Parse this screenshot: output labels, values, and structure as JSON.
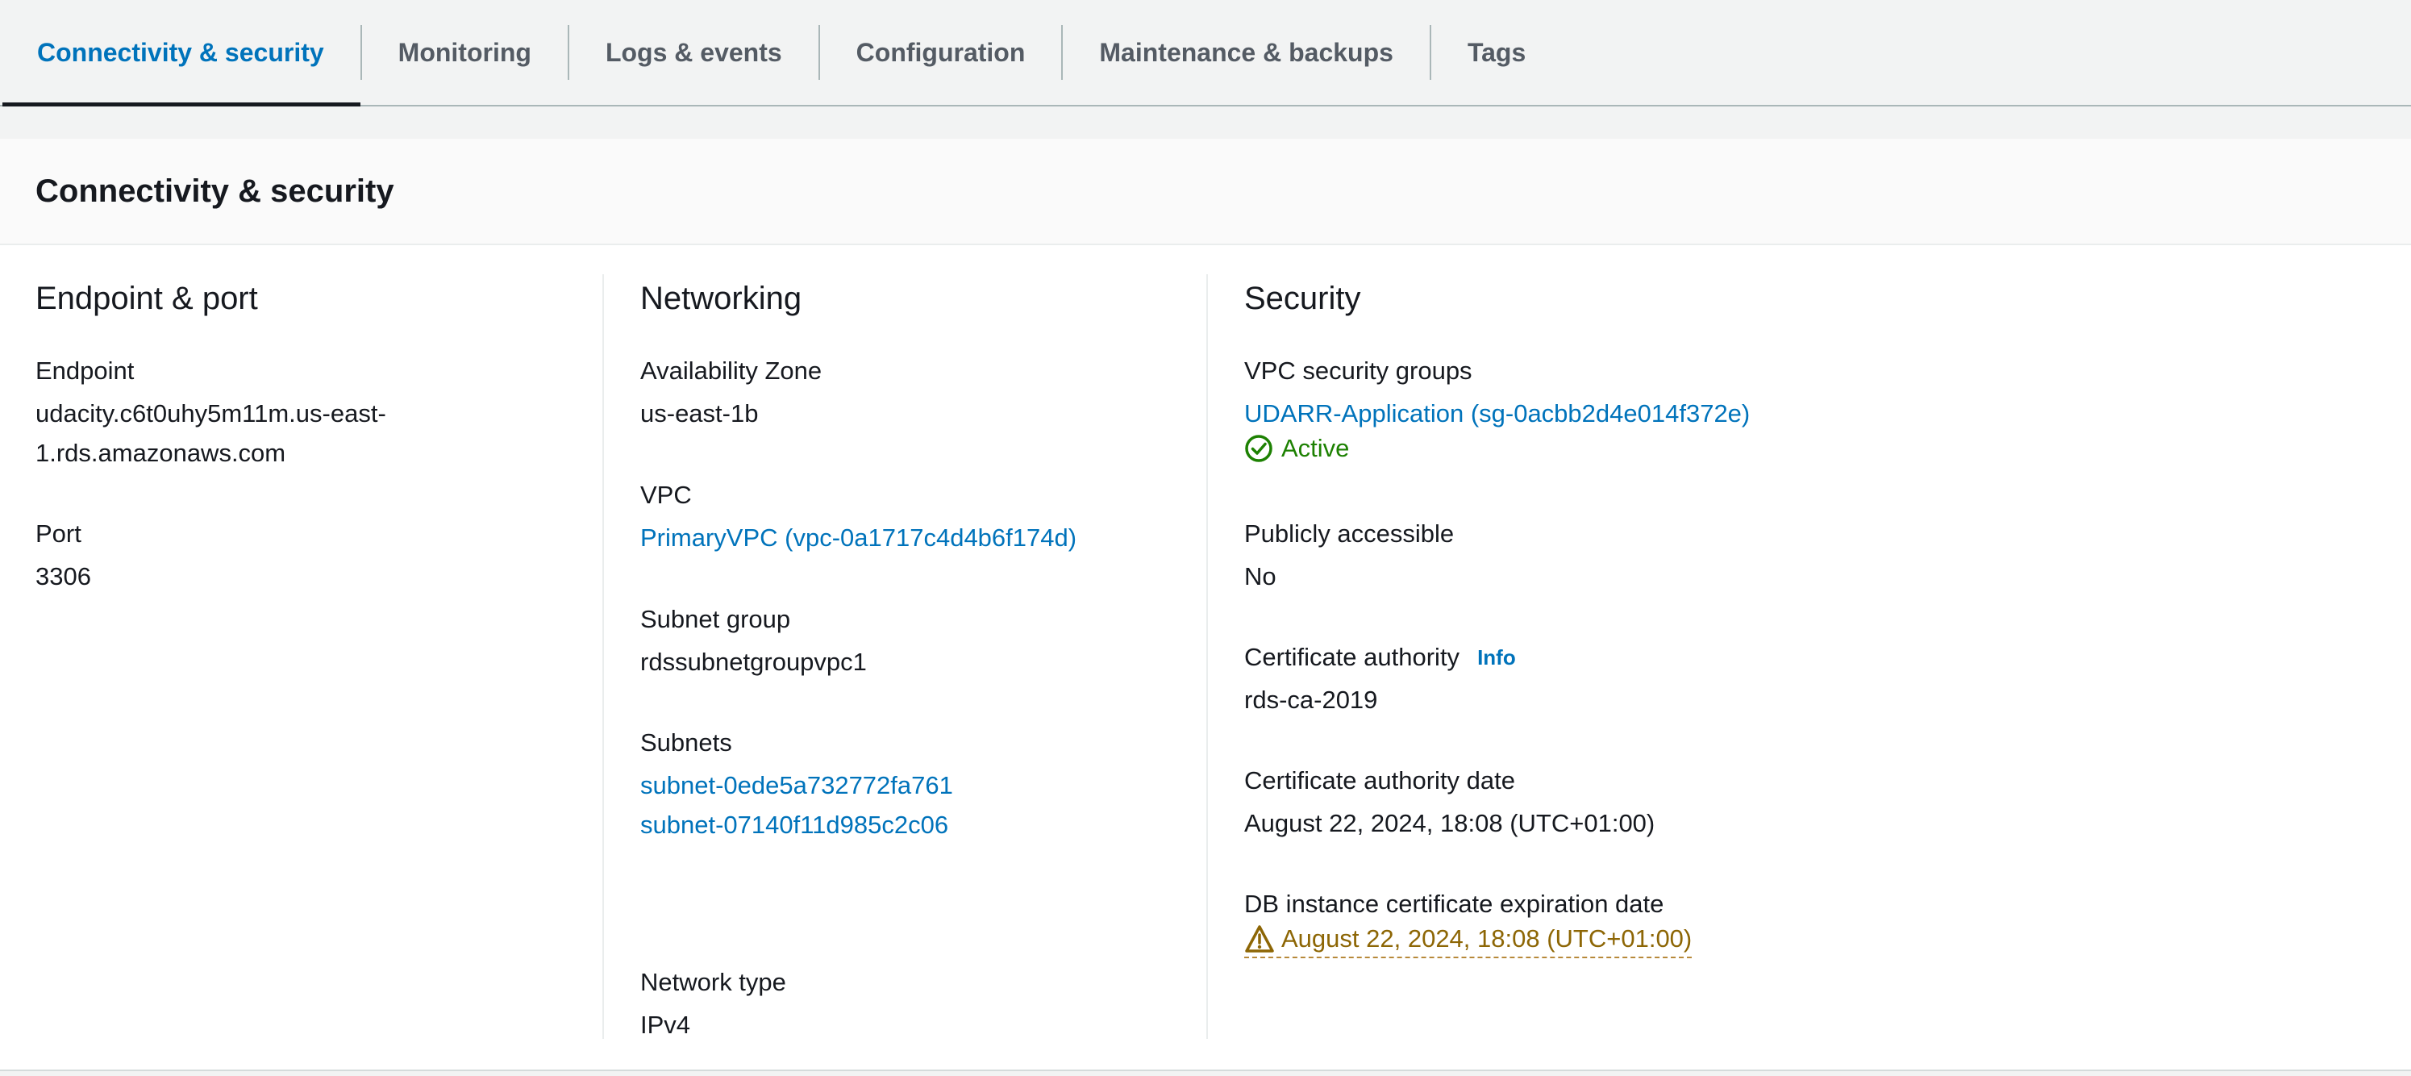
{
  "tabs": [
    {
      "label": "Connectivity & security",
      "active": true
    },
    {
      "label": "Monitoring"
    },
    {
      "label": "Logs & events"
    },
    {
      "label": "Configuration"
    },
    {
      "label": "Maintenance & backups"
    },
    {
      "label": "Tags"
    }
  ],
  "panel": {
    "title": "Connectivity & security"
  },
  "endpoint_port": {
    "heading": "Endpoint & port",
    "endpoint_label": "Endpoint",
    "endpoint_line1": "udacity.c6t0uhy5m11m.us-east-",
    "endpoint_line2": "1.rds.amazonaws.com",
    "port_label": "Port",
    "port_value": "3306"
  },
  "networking": {
    "heading": "Networking",
    "az_label": "Availability Zone",
    "az_value": "us-east-1b",
    "vpc_label": "VPC",
    "vpc_value": "PrimaryVPC (vpc-0a1717c4d4b6f174d)",
    "subnet_group_label": "Subnet group",
    "subnet_group_value": "rdssubnetgroupvpc1",
    "subnets_label": "Subnets",
    "subnets": [
      "subnet-0ede5a732772fa761",
      "subnet-07140f11d985c2c06"
    ],
    "network_type_label": "Network type",
    "network_type_value": "IPv4"
  },
  "security": {
    "heading": "Security",
    "sg_label": "VPC security groups",
    "sg_value": "UDARR-Application (sg-0acbb2d4e014f372e)",
    "sg_status": "Active",
    "public_label": "Publicly accessible",
    "public_value": "No",
    "ca_label": "Certificate authority",
    "ca_info": "Info",
    "ca_value": "rds-ca-2019",
    "ca_date_label": "Certificate authority date",
    "ca_date_value": "August 22, 2024, 18:08 (UTC+01:00)",
    "expiry_label": "DB instance certificate expiration date",
    "expiry_value": "August 22, 2024, 18:08 (UTC+01:00)"
  },
  "colors": {
    "link": "#0073bb",
    "success": "#1d8102",
    "warning": "#8d6605",
    "tab_active_underline": "#16191f"
  },
  "icons": {
    "status_icon": "check-circle-icon",
    "warning_icon": "warning-triangle-icon"
  }
}
